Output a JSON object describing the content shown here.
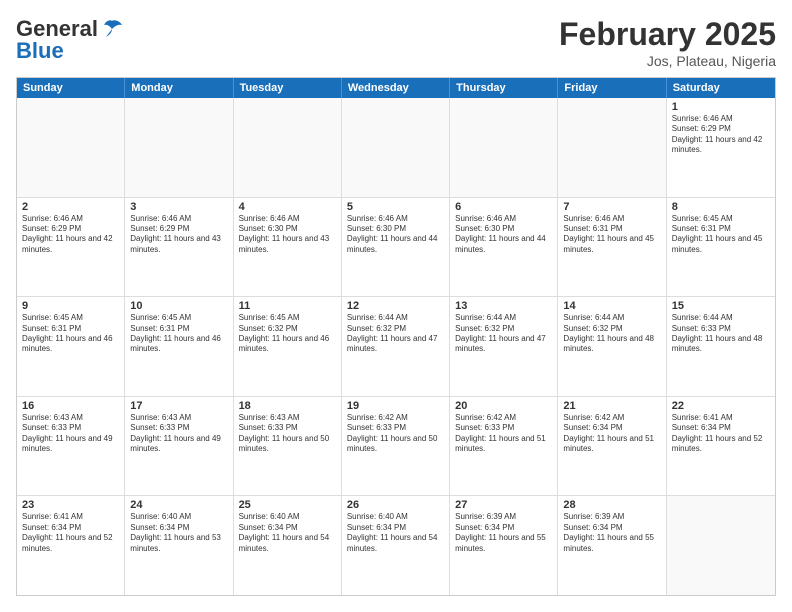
{
  "header": {
    "logo_general": "General",
    "logo_blue": "Blue",
    "title": "February 2025",
    "subtitle": "Jos, Plateau, Nigeria"
  },
  "weekdays": [
    "Sunday",
    "Monday",
    "Tuesday",
    "Wednesday",
    "Thursday",
    "Friday",
    "Saturday"
  ],
  "weeks": [
    [
      {
        "day": "",
        "info": ""
      },
      {
        "day": "",
        "info": ""
      },
      {
        "day": "",
        "info": ""
      },
      {
        "day": "",
        "info": ""
      },
      {
        "day": "",
        "info": ""
      },
      {
        "day": "",
        "info": ""
      },
      {
        "day": "1",
        "info": "Sunrise: 6:46 AM\nSunset: 6:29 PM\nDaylight: 11 hours and 42 minutes."
      }
    ],
    [
      {
        "day": "2",
        "info": "Sunrise: 6:46 AM\nSunset: 6:29 PM\nDaylight: 11 hours and 42 minutes."
      },
      {
        "day": "3",
        "info": "Sunrise: 6:46 AM\nSunset: 6:29 PM\nDaylight: 11 hours and 43 minutes."
      },
      {
        "day": "4",
        "info": "Sunrise: 6:46 AM\nSunset: 6:30 PM\nDaylight: 11 hours and 43 minutes."
      },
      {
        "day": "5",
        "info": "Sunrise: 6:46 AM\nSunset: 6:30 PM\nDaylight: 11 hours and 44 minutes."
      },
      {
        "day": "6",
        "info": "Sunrise: 6:46 AM\nSunset: 6:30 PM\nDaylight: 11 hours and 44 minutes."
      },
      {
        "day": "7",
        "info": "Sunrise: 6:46 AM\nSunset: 6:31 PM\nDaylight: 11 hours and 45 minutes."
      },
      {
        "day": "8",
        "info": "Sunrise: 6:45 AM\nSunset: 6:31 PM\nDaylight: 11 hours and 45 minutes."
      }
    ],
    [
      {
        "day": "9",
        "info": "Sunrise: 6:45 AM\nSunset: 6:31 PM\nDaylight: 11 hours and 46 minutes."
      },
      {
        "day": "10",
        "info": "Sunrise: 6:45 AM\nSunset: 6:31 PM\nDaylight: 11 hours and 46 minutes."
      },
      {
        "day": "11",
        "info": "Sunrise: 6:45 AM\nSunset: 6:32 PM\nDaylight: 11 hours and 46 minutes."
      },
      {
        "day": "12",
        "info": "Sunrise: 6:44 AM\nSunset: 6:32 PM\nDaylight: 11 hours and 47 minutes."
      },
      {
        "day": "13",
        "info": "Sunrise: 6:44 AM\nSunset: 6:32 PM\nDaylight: 11 hours and 47 minutes."
      },
      {
        "day": "14",
        "info": "Sunrise: 6:44 AM\nSunset: 6:32 PM\nDaylight: 11 hours and 48 minutes."
      },
      {
        "day": "15",
        "info": "Sunrise: 6:44 AM\nSunset: 6:33 PM\nDaylight: 11 hours and 48 minutes."
      }
    ],
    [
      {
        "day": "16",
        "info": "Sunrise: 6:43 AM\nSunset: 6:33 PM\nDaylight: 11 hours and 49 minutes."
      },
      {
        "day": "17",
        "info": "Sunrise: 6:43 AM\nSunset: 6:33 PM\nDaylight: 11 hours and 49 minutes."
      },
      {
        "day": "18",
        "info": "Sunrise: 6:43 AM\nSunset: 6:33 PM\nDaylight: 11 hours and 50 minutes."
      },
      {
        "day": "19",
        "info": "Sunrise: 6:42 AM\nSunset: 6:33 PM\nDaylight: 11 hours and 50 minutes."
      },
      {
        "day": "20",
        "info": "Sunrise: 6:42 AM\nSunset: 6:33 PM\nDaylight: 11 hours and 51 minutes."
      },
      {
        "day": "21",
        "info": "Sunrise: 6:42 AM\nSunset: 6:34 PM\nDaylight: 11 hours and 51 minutes."
      },
      {
        "day": "22",
        "info": "Sunrise: 6:41 AM\nSunset: 6:34 PM\nDaylight: 11 hours and 52 minutes."
      }
    ],
    [
      {
        "day": "23",
        "info": "Sunrise: 6:41 AM\nSunset: 6:34 PM\nDaylight: 11 hours and 52 minutes."
      },
      {
        "day": "24",
        "info": "Sunrise: 6:40 AM\nSunset: 6:34 PM\nDaylight: 11 hours and 53 minutes."
      },
      {
        "day": "25",
        "info": "Sunrise: 6:40 AM\nSunset: 6:34 PM\nDaylight: 11 hours and 54 minutes."
      },
      {
        "day": "26",
        "info": "Sunrise: 6:40 AM\nSunset: 6:34 PM\nDaylight: 11 hours and 54 minutes."
      },
      {
        "day": "27",
        "info": "Sunrise: 6:39 AM\nSunset: 6:34 PM\nDaylight: 11 hours and 55 minutes."
      },
      {
        "day": "28",
        "info": "Sunrise: 6:39 AM\nSunset: 6:34 PM\nDaylight: 11 hours and 55 minutes."
      },
      {
        "day": "",
        "info": ""
      }
    ]
  ]
}
